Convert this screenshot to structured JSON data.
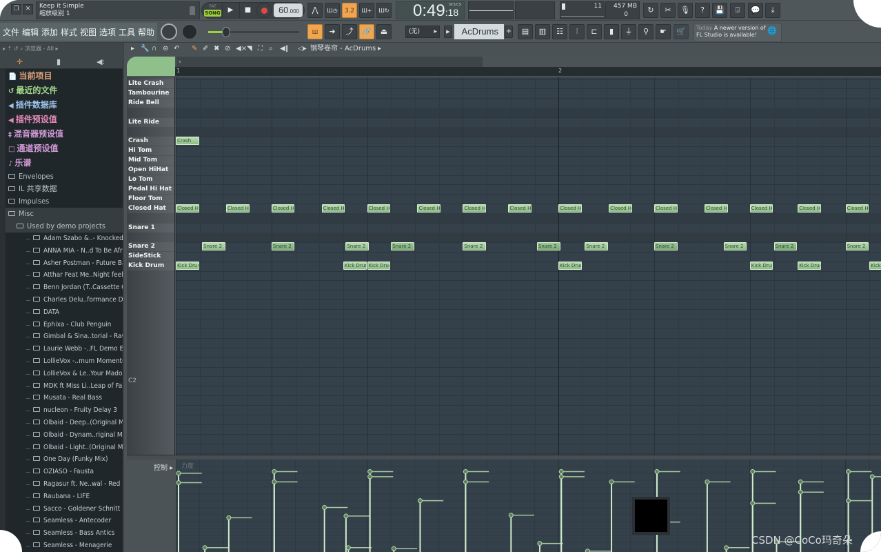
{
  "window": {
    "hint_title": "Keep it Simple",
    "hint_subtitle": "缩放级别 1",
    "restore_icon": "restore-icon",
    "close_icon": "close-icon"
  },
  "transport": {
    "pat_label": "PAT",
    "song_label": "SONG",
    "play_icon": "▶",
    "stop_icon": "■",
    "tempo_int": "60",
    "tempo_frac": ".000",
    "time_main": "0:49",
    "time_cs": "18",
    "time_format": "M:S:CS",
    "pattern_step": "3.2"
  },
  "monitor": {
    "cpu_value": "11",
    "memory": "457 MB",
    "polyphony": "0"
  },
  "menu": {
    "items": [
      "文件",
      "编辑",
      "添加",
      "样式",
      "视图",
      "选项",
      "工具",
      "帮助"
    ]
  },
  "toolbar": {
    "channel_select": "(无)",
    "channel_name": "AcDrums",
    "news_today": "Today",
    "news_text_1": "A newer version of",
    "news_text_2": "FL Studio is available!"
  },
  "browser": {
    "header": "浏览器 - All",
    "top_items": [
      {
        "label": "当前项目",
        "color": "#e4a47a",
        "icon": "📄"
      },
      {
        "label": "最近的文件",
        "color": "#a6d98a",
        "icon": "↺"
      },
      {
        "label": "插件数据库",
        "color": "#9ec2ea",
        "icon": "◀"
      },
      {
        "label": "插件预设值",
        "color": "#e389b8",
        "icon": "◀"
      },
      {
        "label": "混音器预设值",
        "color": "#d29ad6",
        "icon": "‡"
      },
      {
        "label": "通道预设值",
        "color": "#d29ad6",
        "icon": "□"
      },
      {
        "label": "乐谱",
        "color": "#d29ad6",
        "icon": "♪"
      }
    ],
    "folders": [
      "Envelopes",
      "IL 共享数据",
      "Impulses",
      "Misc"
    ],
    "subfolder": "Used by demo projects",
    "demo_projects": [
      "Adam Szabo &..- Knocked Out",
      "ANNA MIA - N..d To Be Afraid",
      "Asher Postman - Future Bass",
      "Atthar Feat Me..Night feeling",
      "Benn Jordan (T..Cassette Cafe",
      "Charles Delu..formance Demo",
      "DATA",
      "Ephixa - Club Penguin",
      "Gimbal & Sina..torial - RawFL",
      "Laurie Webb -..FL Demo Edit)",
      "LollieVox -..mum Momentum",
      "LollieVox & Le..Your Madonna",
      "MDK ft Miss Li..Leap of Faith",
      "Musata - Real Bass",
      "nucleon - Fruity Delay 3",
      "Olbaid - Deep..(Original Mix)",
      "Olbaid - Dynam..riginal Mix)",
      "Olbaid - Light..(Original Mix)",
      "One Day (Funky Mix)",
      "OZIASO - Fausta",
      "Ragasur ft. Ne..wal - Red Rani",
      "Raubana - LIFE",
      "Sacco - Goldener Schnitt",
      "Seamless - Antecoder",
      "Seamless - Bass Antics",
      "Seamless - Menagerie"
    ]
  },
  "piano_roll": {
    "title": "钢琴卷帘 - AcDrums",
    "bar_labels": [
      "1",
      "2"
    ],
    "octave_label": "C2",
    "keys": [
      {
        "label": "Lite Crash",
        "row": 0
      },
      {
        "label": "Tambourine",
        "row": 1
      },
      {
        "label": "Ride Bell",
        "row": 2
      },
      {
        "label": "Lite Ride",
        "row": 4
      },
      {
        "label": "Crash",
        "row": 6
      },
      {
        "label": "Hi Tom",
        "row": 7
      },
      {
        "label": "Mid Tom",
        "row": 8
      },
      {
        "label": "Open HiHat",
        "row": 9
      },
      {
        "label": "Lo Tom",
        "row": 10
      },
      {
        "label": "Pedal Hi Hat",
        "row": 11
      },
      {
        "label": "Floor Tom",
        "row": 12
      },
      {
        "label": "Closed Hat",
        "row": 13
      },
      {
        "label": "Snare 1",
        "row": 15
      },
      {
        "label": "Snare 2",
        "row": 17
      },
      {
        "label": "SideStick",
        "row": 18
      },
      {
        "label": "Kick Drum",
        "row": 19
      }
    ],
    "notes": [
      {
        "name": "Crash",
        "row": 6,
        "step": 0
      },
      {
        "name": "Closed Hat",
        "row": 13,
        "step": 0
      },
      {
        "name": "Closed Hat",
        "row": 13,
        "step": 2.1
      },
      {
        "name": "Closed Hat",
        "row": 13,
        "step": 4
      },
      {
        "name": "Closed Hat",
        "row": 13,
        "step": 6.1
      },
      {
        "name": "Closed Hat",
        "row": 13,
        "step": 8
      },
      {
        "name": "Closed Hat",
        "row": 13,
        "step": 10.1
      },
      {
        "name": "Closed Hat",
        "row": 13,
        "step": 12
      },
      {
        "name": "Closed Hat",
        "row": 13,
        "step": 13.9
      },
      {
        "name": "Closed Hat",
        "row": 13,
        "step": 16
      },
      {
        "name": "Closed Hat",
        "row": 13,
        "step": 18.1
      },
      {
        "name": "Closed Hat",
        "row": 13,
        "step": 20
      },
      {
        "name": "Closed Hat",
        "row": 13,
        "step": 22.1
      },
      {
        "name": "Closed Hat",
        "row": 13,
        "step": 24
      },
      {
        "name": "Closed Hat",
        "row": 13,
        "step": 26
      },
      {
        "name": "Closed Hat",
        "row": 13,
        "step": 28
      },
      {
        "name": "Snare 2",
        "row": 17,
        "step": 1.1
      },
      {
        "name": "Snare 2",
        "row": 17,
        "step": 4
      },
      {
        "name": "Snare 2",
        "row": 17,
        "step": 7.1
      },
      {
        "name": "Snare 2",
        "row": 17,
        "step": 9
      },
      {
        "name": "Snare 2",
        "row": 17,
        "step": 12
      },
      {
        "name": "Snare 2",
        "row": 17,
        "step": 15.1
      },
      {
        "name": "Snare 2",
        "row": 17,
        "step": 17.1
      },
      {
        "name": "Snare 2",
        "row": 17,
        "step": 20
      },
      {
        "name": "Snare 2",
        "row": 17,
        "step": 22.9
      },
      {
        "name": "Snare 2",
        "row": 17,
        "step": 25
      },
      {
        "name": "Snare 2",
        "row": 17,
        "step": 28
      },
      {
        "name": "Kick Drum",
        "row": 19,
        "step": 0
      },
      {
        "name": "Kick Drum",
        "row": 19,
        "step": 7
      },
      {
        "name": "Kick Drum",
        "row": 19,
        "step": 8
      },
      {
        "name": "Kick Drum",
        "row": 19,
        "step": 16
      },
      {
        "name": "Kick Drum",
        "row": 19,
        "step": 24
      },
      {
        "name": "Kick Drum",
        "row": 19,
        "step": 26
      },
      {
        "name": "Kick Drum",
        "row": 19,
        "step": 29
      }
    ]
  },
  "control_lane": {
    "label": "控制",
    "param": "力度",
    "velocities": [
      {
        "step": 0,
        "v": 0.92
      },
      {
        "step": 0,
        "v": 0.81
      },
      {
        "step": 1.1,
        "v": 0.05
      },
      {
        "step": 2.1,
        "v": 0.4
      },
      {
        "step": 4,
        "v": 0.94
      },
      {
        "step": 4,
        "v": 0.82
      },
      {
        "step": 6.1,
        "v": 0.52
      },
      {
        "step": 7,
        "v": 0.42
      },
      {
        "step": 7.1,
        "v": 0.05
      },
      {
        "step": 8,
        "v": 0.94
      },
      {
        "step": 8,
        "v": 0.88
      },
      {
        "step": 9,
        "v": 0.04
      },
      {
        "step": 10.1,
        "v": 0.6
      },
      {
        "step": 12,
        "v": 0.94
      },
      {
        "step": 12,
        "v": 0.82
      },
      {
        "step": 13.9,
        "v": 0.43
      },
      {
        "step": 15.1,
        "v": 0.1
      },
      {
        "step": 16,
        "v": 0.94
      },
      {
        "step": 16,
        "v": 0.88
      },
      {
        "step": 17.1,
        "v": 0.01
      },
      {
        "step": 18.1,
        "v": 0.82
      },
      {
        "step": 20,
        "v": 0.94
      },
      {
        "step": 20,
        "v": 0.35
      },
      {
        "step": 22.1,
        "v": 0.82
      },
      {
        "step": 22.9,
        "v": 0.05
      },
      {
        "step": 24,
        "v": 0.94
      },
      {
        "step": 24,
        "v": 0.57
      },
      {
        "step": 25,
        "v": 0.12
      },
      {
        "step": 26,
        "v": 0.82
      },
      {
        "step": 26,
        "v": 0.7
      },
      {
        "step": 28,
        "v": 0.94
      },
      {
        "step": 28,
        "v": 0.6
      },
      {
        "step": 29,
        "v": 0.88
      }
    ]
  },
  "watermark": "CSDN @CoCo玛奇朵"
}
